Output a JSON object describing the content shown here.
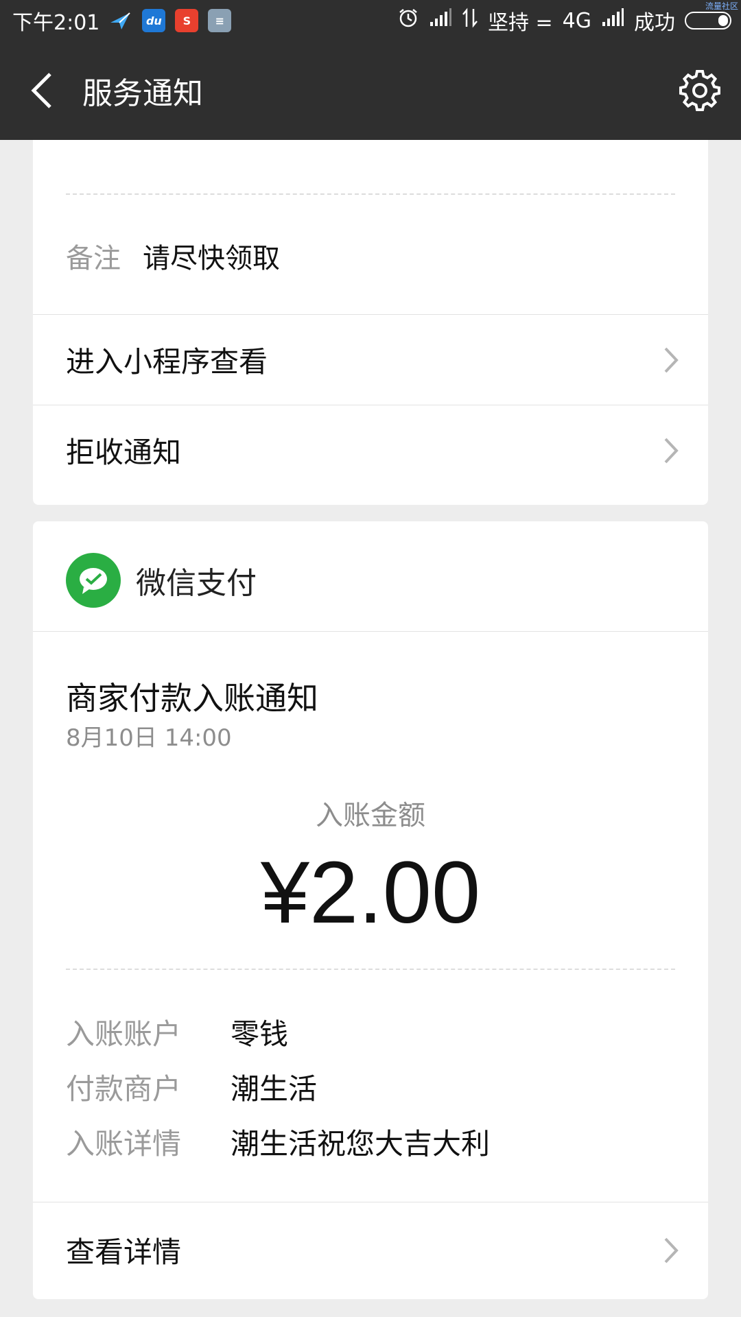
{
  "status_bar": {
    "time": "下午2:01",
    "carrier1": "坚持",
    "carrier1_suffix": "=",
    "network": "4G",
    "carrier2": "成功",
    "watermark": "流量社区",
    "apps": [
      "bird-app-icon",
      "du-app-icon",
      "s360-app-icon",
      "notes-app-icon"
    ]
  },
  "nav": {
    "title": "服务通知"
  },
  "card1": {
    "remark_key": "备注",
    "remark_value": "请尽快领取",
    "rows": [
      {
        "label": "进入小程序查看"
      },
      {
        "label": "拒收通知"
      }
    ]
  },
  "card2": {
    "brand": "微信支付",
    "title": "商家付款入账通知",
    "time": "8月10日  14:00",
    "amount_label": "入账金额",
    "amount": "¥2.00",
    "details": [
      {
        "key": "入账账户",
        "value": "零钱"
      },
      {
        "key": "付款商户",
        "value": "潮生活"
      },
      {
        "key": "入账详情",
        "value": "潮生活祝您大吉大利"
      }
    ],
    "footer_link": "查看详情"
  },
  "colors": {
    "bar": "#2f2f2f",
    "background": "#ededed",
    "wxpay_green": "#2aae43"
  }
}
